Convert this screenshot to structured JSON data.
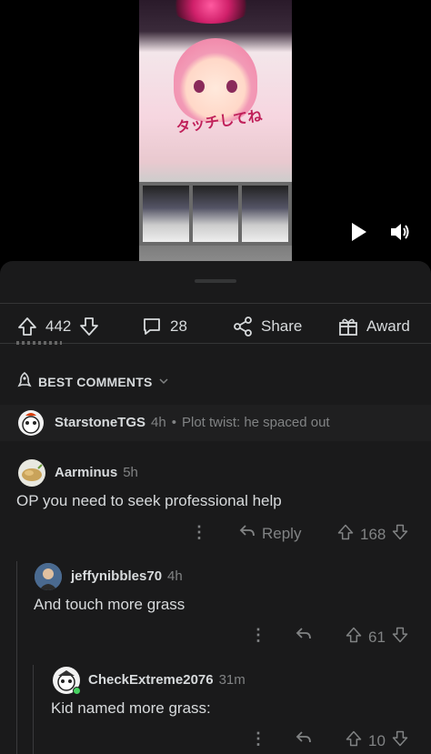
{
  "video": {
    "overlay_text": "タッチしてね",
    "play_icon": "play-icon",
    "volume_icon": "volume-icon"
  },
  "post_actions": {
    "upvote_count": "442",
    "comment_count": "28",
    "share_label": "Share",
    "award_label": "Award"
  },
  "sort": {
    "label": "BEST COMMENTS"
  },
  "comments": [
    {
      "username": "StarstoneTGS",
      "age": "4h",
      "separator": "•",
      "preview": "Plot twist: he spaced out",
      "collapsed": true
    },
    {
      "username": "Aarminus",
      "age": "5h",
      "body": "OP you need to seek professional help",
      "reply_label": "Reply",
      "score": "168"
    },
    {
      "username": "jeffynibbles70",
      "age": "4h",
      "body": "And touch more grass",
      "score": "61"
    },
    {
      "username": "CheckExtreme2076",
      "age": "31m",
      "body": "Kid named more grass:",
      "score": "10"
    }
  ],
  "colors": {
    "background": "#1a1a1b",
    "text": "#d7dadc",
    "muted": "#818384",
    "online": "#46d160"
  }
}
